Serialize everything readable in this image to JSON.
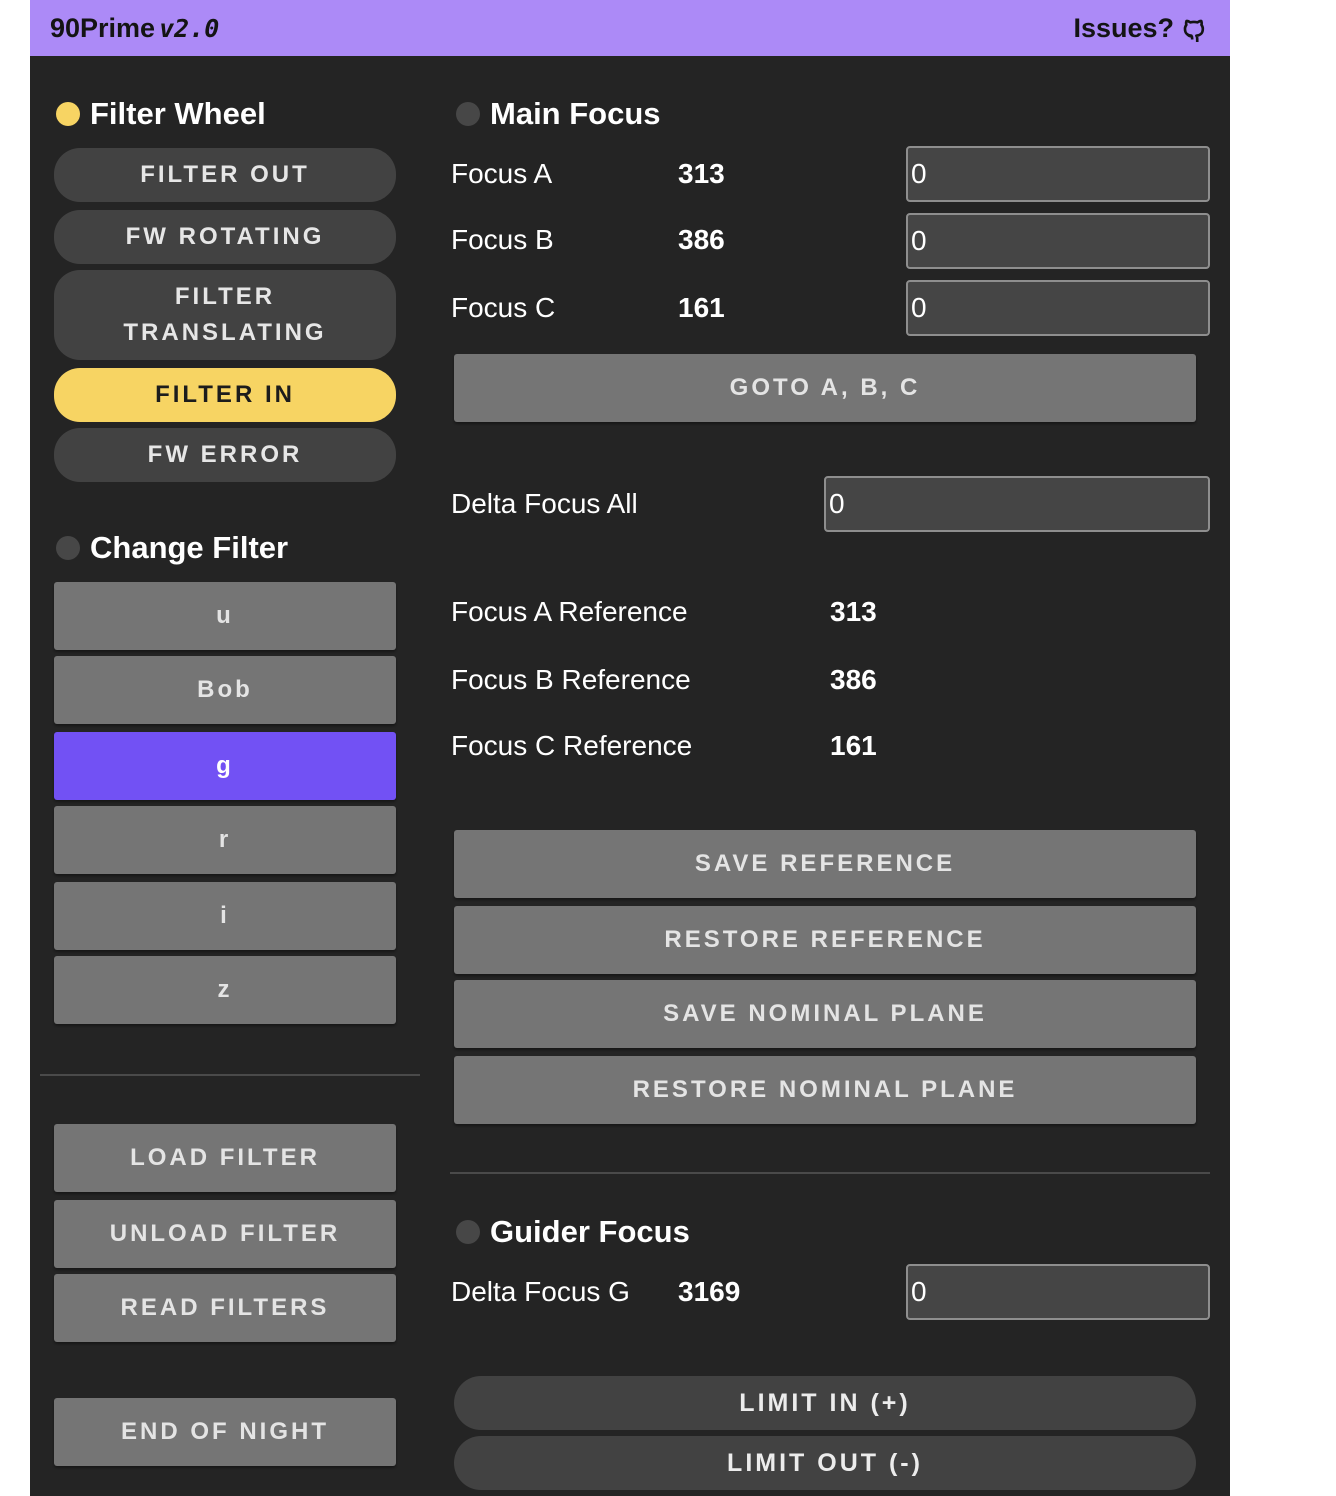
{
  "header": {
    "brand": "90Prime",
    "version": "v2.0",
    "issues_label": "Issues?"
  },
  "filter_wheel": {
    "title": "Filter Wheel",
    "indicator_color": "#f7d463",
    "states": [
      {
        "label": "FILTER OUT",
        "active": false
      },
      {
        "label": "FW ROTATING",
        "active": false
      },
      {
        "label": "FILTER TRANSLATING",
        "active": false
      },
      {
        "label": "FILTER IN",
        "active": true
      },
      {
        "label": "FW ERROR",
        "active": false
      }
    ]
  },
  "change_filter": {
    "title": "Change Filter",
    "filters": [
      "u",
      "Bob",
      "g",
      "r",
      "i",
      "z"
    ],
    "selected": "g",
    "selected_color": "#7251f4"
  },
  "filter_actions": {
    "load": "LOAD FILTER",
    "unload": "UNLOAD FILTER",
    "read": "READ FILTERS",
    "end_of_night": "END OF NIGHT"
  },
  "main_focus": {
    "title": "Main Focus",
    "rows": [
      {
        "label": "Focus A",
        "value": "313",
        "input": "0"
      },
      {
        "label": "Focus B",
        "value": "386",
        "input": "0"
      },
      {
        "label": "Focus C",
        "value": "161",
        "input": "0"
      }
    ],
    "goto_label": "GOTO A, B, C",
    "delta_all_label": "Delta Focus All",
    "delta_all_input": "0",
    "references": [
      {
        "label": "Focus A Reference",
        "value": "313"
      },
      {
        "label": "Focus B Reference",
        "value": "386"
      },
      {
        "label": "Focus C Reference",
        "value": "161"
      }
    ],
    "save_reference": "SAVE REFERENCE",
    "restore_reference": "RESTORE REFERENCE",
    "save_nominal": "SAVE NOMINAL PLANE",
    "restore_nominal": "RESTORE NOMINAL PLANE"
  },
  "guider_focus": {
    "title": "Guider Focus",
    "delta_label": "Delta Focus G",
    "delta_value": "3169",
    "delta_input": "0",
    "limit_in": "LIMIT IN (+)",
    "limit_out": "LIMIT OUT (-)"
  }
}
